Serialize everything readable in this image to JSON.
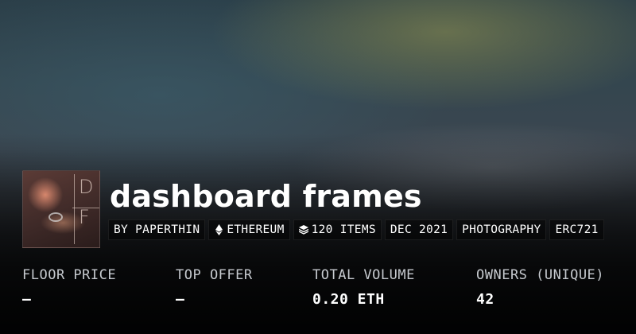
{
  "collection": {
    "title": "dashboard frames",
    "thumbnail_alt": "collection-thumbnail"
  },
  "tags": [
    {
      "icon": "",
      "label": "BY PAPERTHIN"
    },
    {
      "icon": "ethereum-icon",
      "label": "ETHEREUM"
    },
    {
      "icon": "layers-icon",
      "label": "120 ITEMS"
    },
    {
      "icon": "",
      "label": "DEC 2021"
    },
    {
      "icon": "",
      "label": "PHOTOGRAPHY"
    },
    {
      "icon": "",
      "label": "ERC721"
    }
  ],
  "stats": [
    {
      "label": "FLOOR PRICE",
      "value": "—"
    },
    {
      "label": "TOP OFFER",
      "value": "—"
    },
    {
      "label": "TOTAL VOLUME",
      "value": "0.20 ETH"
    },
    {
      "label": "OWNERS (UNIQUE)",
      "value": "42"
    }
  ]
}
